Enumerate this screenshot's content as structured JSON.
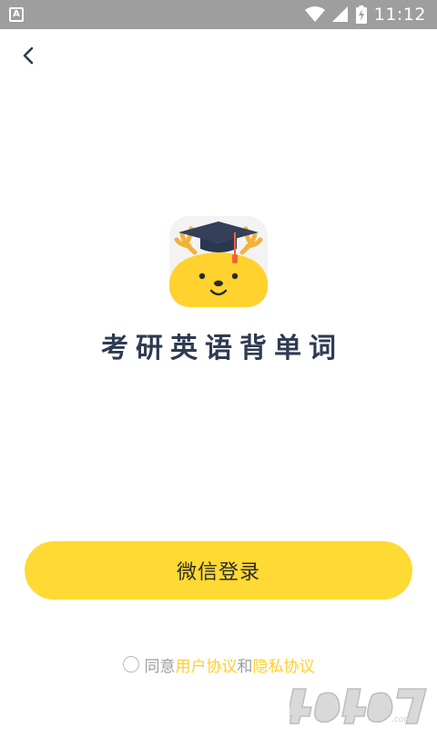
{
  "status_bar": {
    "time": "11:12",
    "notification_icon": "a-letter-icon",
    "icons": [
      "wifi-icon",
      "signal-icon",
      "battery-charging-icon"
    ]
  },
  "nav": {
    "back_icon": "chevron-left-icon"
  },
  "app": {
    "title": "考研英语背单词",
    "logo_icon": "deer-graduation-cap-logo"
  },
  "login": {
    "wechat_label": "微信登录"
  },
  "agreement": {
    "agree_text": "同意",
    "user_agreement": "用户协议",
    "and_text": "和",
    "privacy_agreement": "隐私协议"
  },
  "watermark": "4U4U.com",
  "colors": {
    "accent": "#ffda34",
    "link": "#ffcf2b",
    "title": "#2f3b52",
    "status_bar": "#9e9e9e"
  }
}
